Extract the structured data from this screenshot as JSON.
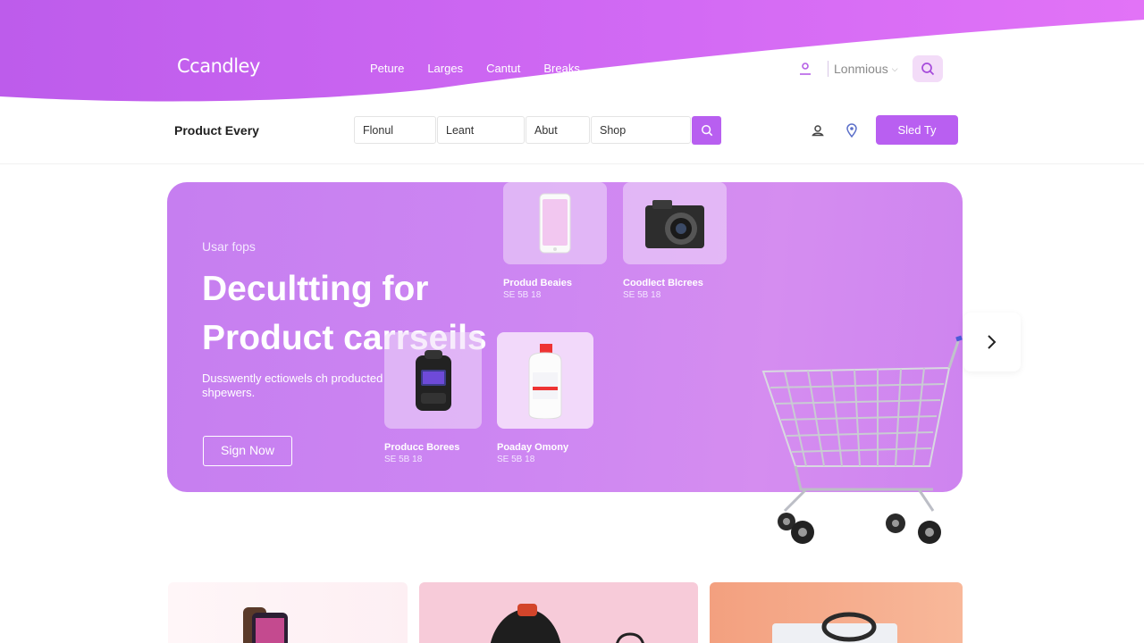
{
  "brand": {
    "logo": "Ccandley"
  },
  "top_nav": {
    "items": [
      "Peture",
      "Larges",
      "Cantut",
      "Breaks"
    ]
  },
  "top_right": {
    "language": "Lonmious"
  },
  "subheader": {
    "title": "Product Every",
    "filters": [
      "Flonul",
      "Leant",
      "Abut",
      "Shop"
    ],
    "cta": "Sled Ty"
  },
  "hero": {
    "kicker": "Usar fops",
    "title_line1": "Decultting for",
    "title_line2": "Product carrseils",
    "description": "Dusswently ectiowels ch producted shpewers.",
    "button": "Sign Now"
  },
  "products": [
    {
      "name": "Produd Beaies",
      "price": "SE 5B 18"
    },
    {
      "name": "Coodlect Blcrees",
      "price": "SE 5B 18"
    },
    {
      "name": "Producc Borees",
      "price": "SE 5B 18"
    },
    {
      "name": "Poaday Omony",
      "price": "SE 5B 18"
    }
  ],
  "colors": {
    "accent": "#b95ff1",
    "hero_bg": "#cd86f2",
    "wave_start": "#c05ef0",
    "wave_end": "#e070f5"
  },
  "icons": [
    "user-icon",
    "chevron-down-icon",
    "search-icon",
    "account-icon",
    "location-pin-icon",
    "chevron-right-icon",
    "shopping-cart-icon"
  ]
}
